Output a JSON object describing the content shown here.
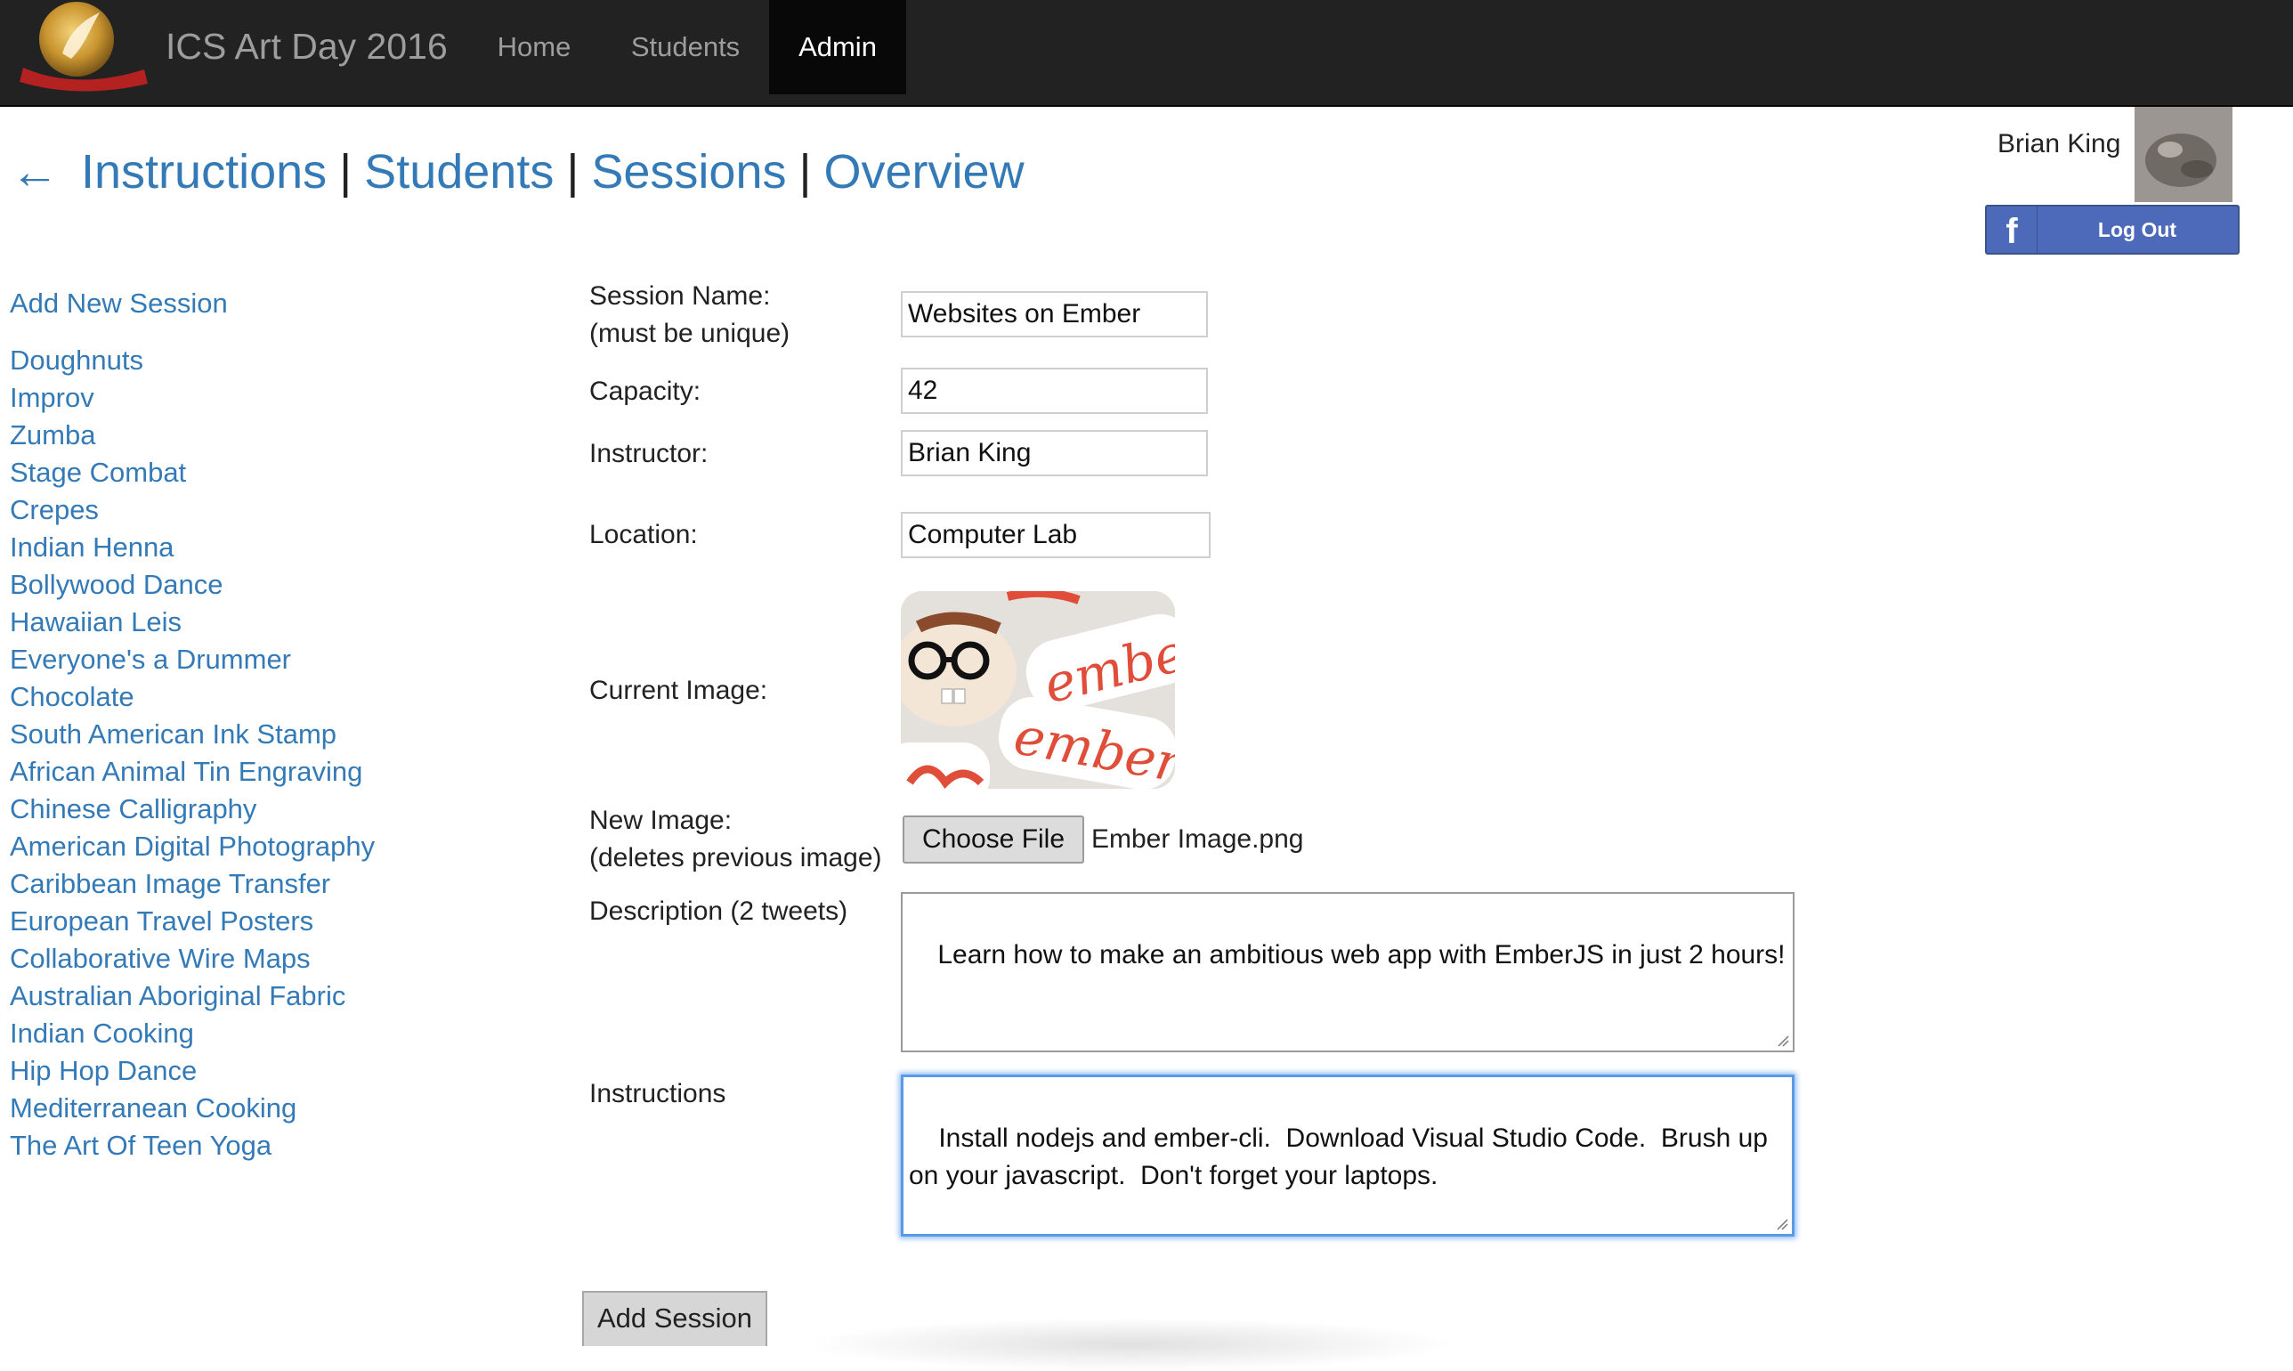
{
  "navbar": {
    "brand": "ICS Art Day 2016",
    "items": [
      {
        "label": "Home"
      },
      {
        "label": "Students"
      },
      {
        "label": "Admin"
      }
    ]
  },
  "user": {
    "name": "Brian King",
    "logout_label": "Log Out",
    "facebook_glyph": "f"
  },
  "breadcrumb": {
    "back_arrow": "←",
    "links": [
      "Instructions",
      "Students",
      "Sessions",
      "Overview"
    ],
    "separator": "|"
  },
  "sidebar": {
    "add_new": "Add New Session",
    "sessions": [
      "Doughnuts",
      "Improv",
      "Zumba",
      "Stage Combat",
      "Crepes",
      "Indian Henna",
      "Bollywood Dance",
      "Hawaiian Leis",
      "Everyone's a Drummer",
      "Chocolate",
      "South American Ink Stamp",
      "African Animal Tin Engraving",
      "Chinese Calligraphy",
      "American Digital Photography",
      "Caribbean Image Transfer",
      "European Travel Posters",
      "Collaborative Wire Maps",
      "Australian Aboriginal Fabric",
      "Indian Cooking",
      "Hip Hop Dance",
      "Mediterranean Cooking",
      "The Art Of Teen Yoga"
    ]
  },
  "form": {
    "session_name_label_1": "Session Name:",
    "session_name_label_2": "(must be unique)",
    "session_name": "Websites on Ember",
    "capacity_label": "Capacity:",
    "capacity": "42",
    "instructor_label": "Instructor:",
    "instructor": "Brian King",
    "location_label": "Location:",
    "location": "Computer Lab",
    "current_image_label": "Current Image:",
    "current_image_text": "ember",
    "new_image_label_1": "New Image:",
    "new_image_label_2": "(deletes previous image)",
    "choose_file": "Choose File",
    "file_name": "Ember Image.png",
    "description_label": "Description (2 tweets)",
    "description": "Learn how to make an ambitious web app with EmberJS in just 2 hours!",
    "instructions_label": "Instructions",
    "instructions": "Install nodejs and ember-cli.  Download Visual Studio Code.  Brush up on your javascript.  Don't forget your laptops.",
    "submit": "Add Session"
  },
  "colors": {
    "navbar_bg": "#222222",
    "link": "#337ab7",
    "facebook": "#4c69ba",
    "focus": "#5b9ae8"
  }
}
